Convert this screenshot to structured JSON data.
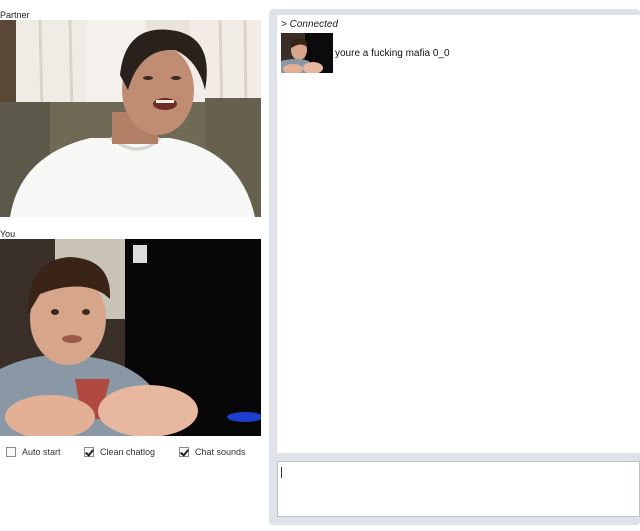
{
  "partner": {
    "label": "Partner"
  },
  "you": {
    "label": "You"
  },
  "options": [
    {
      "label": "Auto start",
      "checked": false
    },
    {
      "label": "Clean chatlog",
      "checked": true
    },
    {
      "label": "Chat sounds",
      "checked": true
    }
  ],
  "chat": {
    "status": "> Connected",
    "messages": [
      {
        "text": "youre a fucking mafia 0_0"
      }
    ],
    "input_value": ""
  },
  "colors": {
    "frame": "#dee3ea",
    "input_border": "#b9c3cf"
  }
}
